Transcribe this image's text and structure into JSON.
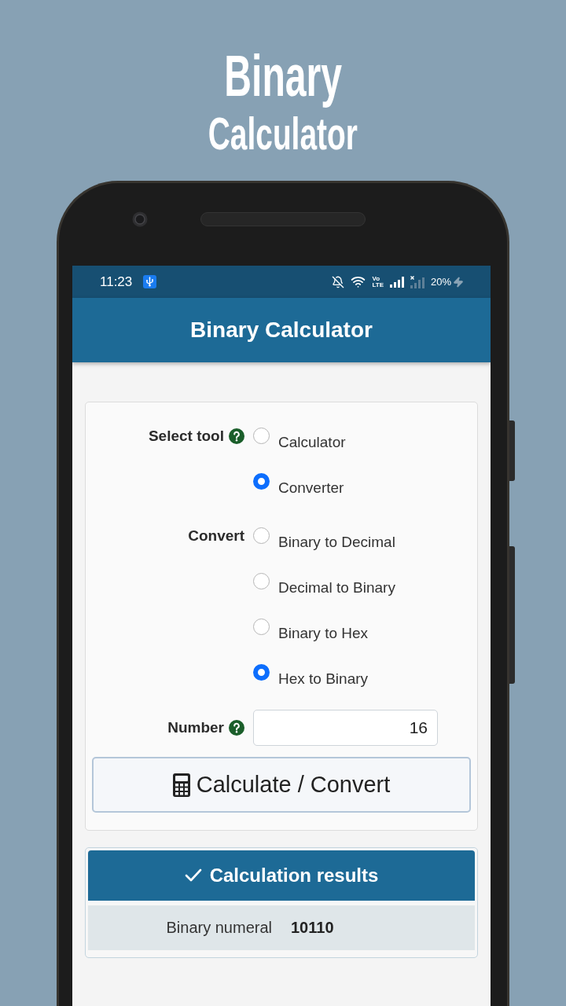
{
  "promo": {
    "title_lines": [
      "Binary",
      "Calculator"
    ]
  },
  "status_bar": {
    "time": "11:23",
    "volte": [
      "Vo",
      "LTE"
    ],
    "battery": "20%"
  },
  "app_bar": {
    "title": "Binary Calculator"
  },
  "form": {
    "fields": [
      {
        "kind": "radio_group",
        "label": "Select tool",
        "help": true,
        "options": [
          {
            "label": "Calculator",
            "selected": false
          },
          {
            "label": "Converter",
            "selected": true
          }
        ]
      },
      {
        "kind": "radio_group",
        "label": "Convert",
        "help": false,
        "options": [
          {
            "label": "Binary to Decimal",
            "selected": false
          },
          {
            "label": "Decimal to Binary",
            "selected": false
          },
          {
            "label": "Binary to Hex",
            "selected": false
          },
          {
            "label": "Hex to Binary",
            "selected": true
          }
        ]
      },
      {
        "kind": "number_input",
        "label": "Number",
        "help": true,
        "value": "16"
      }
    ],
    "submit_button": {
      "label": "Calculate / Convert"
    }
  },
  "results": {
    "title": "Calculation results",
    "rows": [
      {
        "label": "Binary numeral",
        "value": "10110"
      }
    ]
  }
}
